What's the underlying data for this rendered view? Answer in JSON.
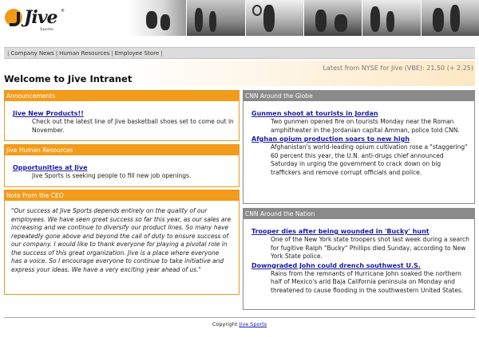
{
  "brand": {
    "logo_word": "Jive",
    "logo_sub": "Sports."
  },
  "nav": {
    "links": [
      {
        "label": "Company News"
      },
      {
        "label": "Human Resources"
      },
      {
        "label": "Employee Store"
      }
    ]
  },
  "stock": {
    "text": "Latest from NYSE for Jive (VBE): 21.50 (+ 2.25)"
  },
  "page": {
    "title": "Welcome to Jive Intranet"
  },
  "panels": {
    "announcements": {
      "title": "Announcements",
      "link": "Jive New Products!!",
      "text": "Check out the latest line of Jive basketball shoes set to come out in November."
    },
    "hr": {
      "title": "Jive Human Resources",
      "link": "Opportunities at Jive",
      "text": "Jive Sports is seeking people to fill new job openings."
    },
    "ceo": {
      "title": "Note From the CEO",
      "text": "\"Our success at Jive Sports depends entirely on the quality of our employees. We have seen great success so far this year, as our sales are increasing and we continue to diversify our product lines. So many have repeatedly gone above and beyond the call of duty to ensure success of our company. I would like to thank everyone for playing a pivotal role in the success of this great organization. Jive is a place where everyone has a voice. So I encourage everyone to continue to take initiative and express your ideas. We have a very exciting year ahead of us.\""
    },
    "globe": {
      "title": "CNN Around the Globe",
      "items": [
        {
          "headline": "Gunmen shoot at tourists in Jordan",
          "summary": "Two gunmen opened fire on tourists Monday near the Roman amphitheater in the Jordanian capital Amman, police told CNN."
        },
        {
          "headline": "Afghan opium production soars to new high",
          "summary": "Afghanistan's world-leading opium cultivation rose a \"staggering\" 60 percent this year, the U.N. anti-drugs chief announced Saturday in urging the government to crack down on big traffickers and remove corrupt officials and police."
        }
      ]
    },
    "nation": {
      "title": "CNN Around the Nation",
      "items": [
        {
          "headline": "Trooper dies after being wounded in 'Bucky' hunt",
          "summary": "One of the New York state troopers shot last week during a search for fugitive Ralph \"Bucky\" Phillips died Sunday, according to New York State police."
        },
        {
          "headline": "Downgraded John could drench southwest U.S.",
          "summary": "Rains from the remnants of Hurricane John soaked the northern half of Mexico's arid Baja California peninsula on Monday and threatened to cause flooding in the southwestern United States."
        }
      ]
    }
  },
  "footer": {
    "prefix": "Copyright",
    "link": "Jive Sports"
  },
  "colors": {
    "orange_header": "#f39b1a",
    "gray_header": "#8a8a8a",
    "link_blue": "#1a1aa0"
  }
}
